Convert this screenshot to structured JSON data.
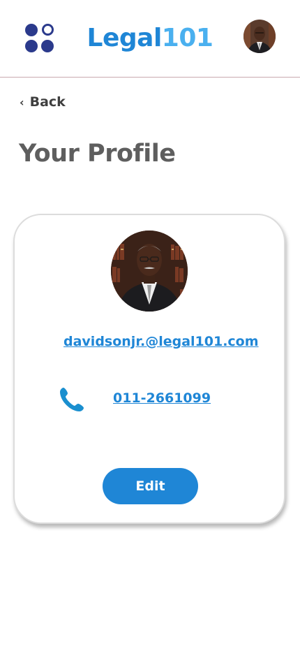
{
  "header": {
    "logo_main": "Legal",
    "logo_number": "101"
  },
  "nav": {
    "back_label": "Back"
  },
  "page": {
    "title": "Your Profile"
  },
  "profile": {
    "email": "davidsonjr.@legal101.com",
    "phone": "011-2661099",
    "edit_label": "Edit"
  },
  "icons": {
    "menu": "grid-dots-icon",
    "back": "chevron-left-icon",
    "phone": "phone-icon"
  },
  "colors": {
    "brand_primary": "#1f86d6",
    "brand_light": "#4ab0ef",
    "menu_dots": "#2b3a8c",
    "title_gray": "#5e5e5e",
    "header_divider": "#c9a9ae"
  }
}
